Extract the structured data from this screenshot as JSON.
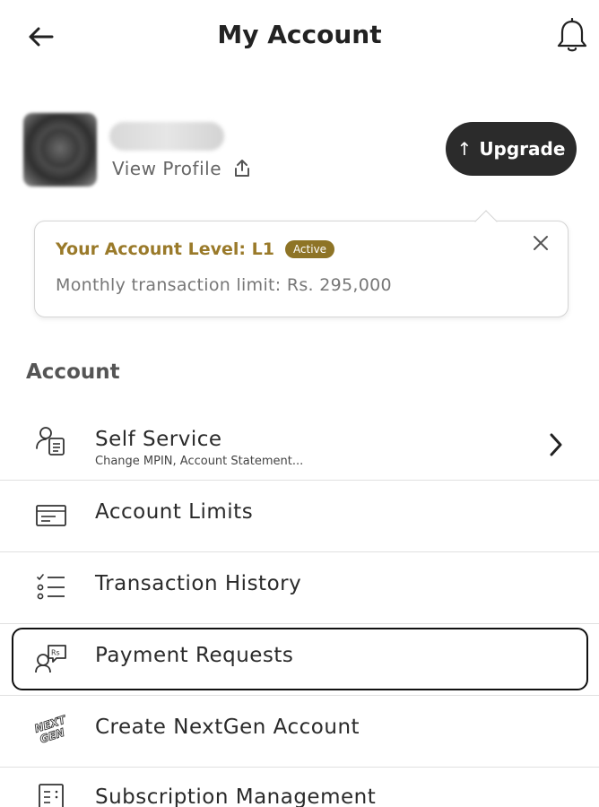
{
  "header": {
    "title": "My Account",
    "back_icon": "back-arrow-icon",
    "bell_icon": "bell-icon"
  },
  "profile": {
    "view_profile_label": "View Profile",
    "share_icon": "share-icon",
    "upgrade_label": "Upgrade",
    "upgrade_arrow": "↑"
  },
  "account_level": {
    "title": "Your Account Level: L1",
    "badge": "Active",
    "limit_text": "Monthly transaction limit: Rs. 295,000"
  },
  "section": {
    "title": "Account"
  },
  "menu": [
    {
      "label": "Self Service",
      "sublabel": "Change MPIN, Account Statement...",
      "icon": "self-service-icon"
    },
    {
      "label": "Account Limits",
      "icon": "account-limits-icon"
    },
    {
      "label": "Transaction History",
      "icon": "transaction-history-icon"
    },
    {
      "label": "Payment Requests",
      "icon": "payment-requests-icon"
    },
    {
      "label": "Create NextGen Account",
      "icon": "nextgen-icon"
    },
    {
      "label": "Subscription Management",
      "icon": "subscription-icon"
    }
  ],
  "colors": {
    "accent_gold": "#9a7a2a",
    "badge_bg": "#8e7426",
    "upgrade_bg": "#2b2b2b"
  }
}
